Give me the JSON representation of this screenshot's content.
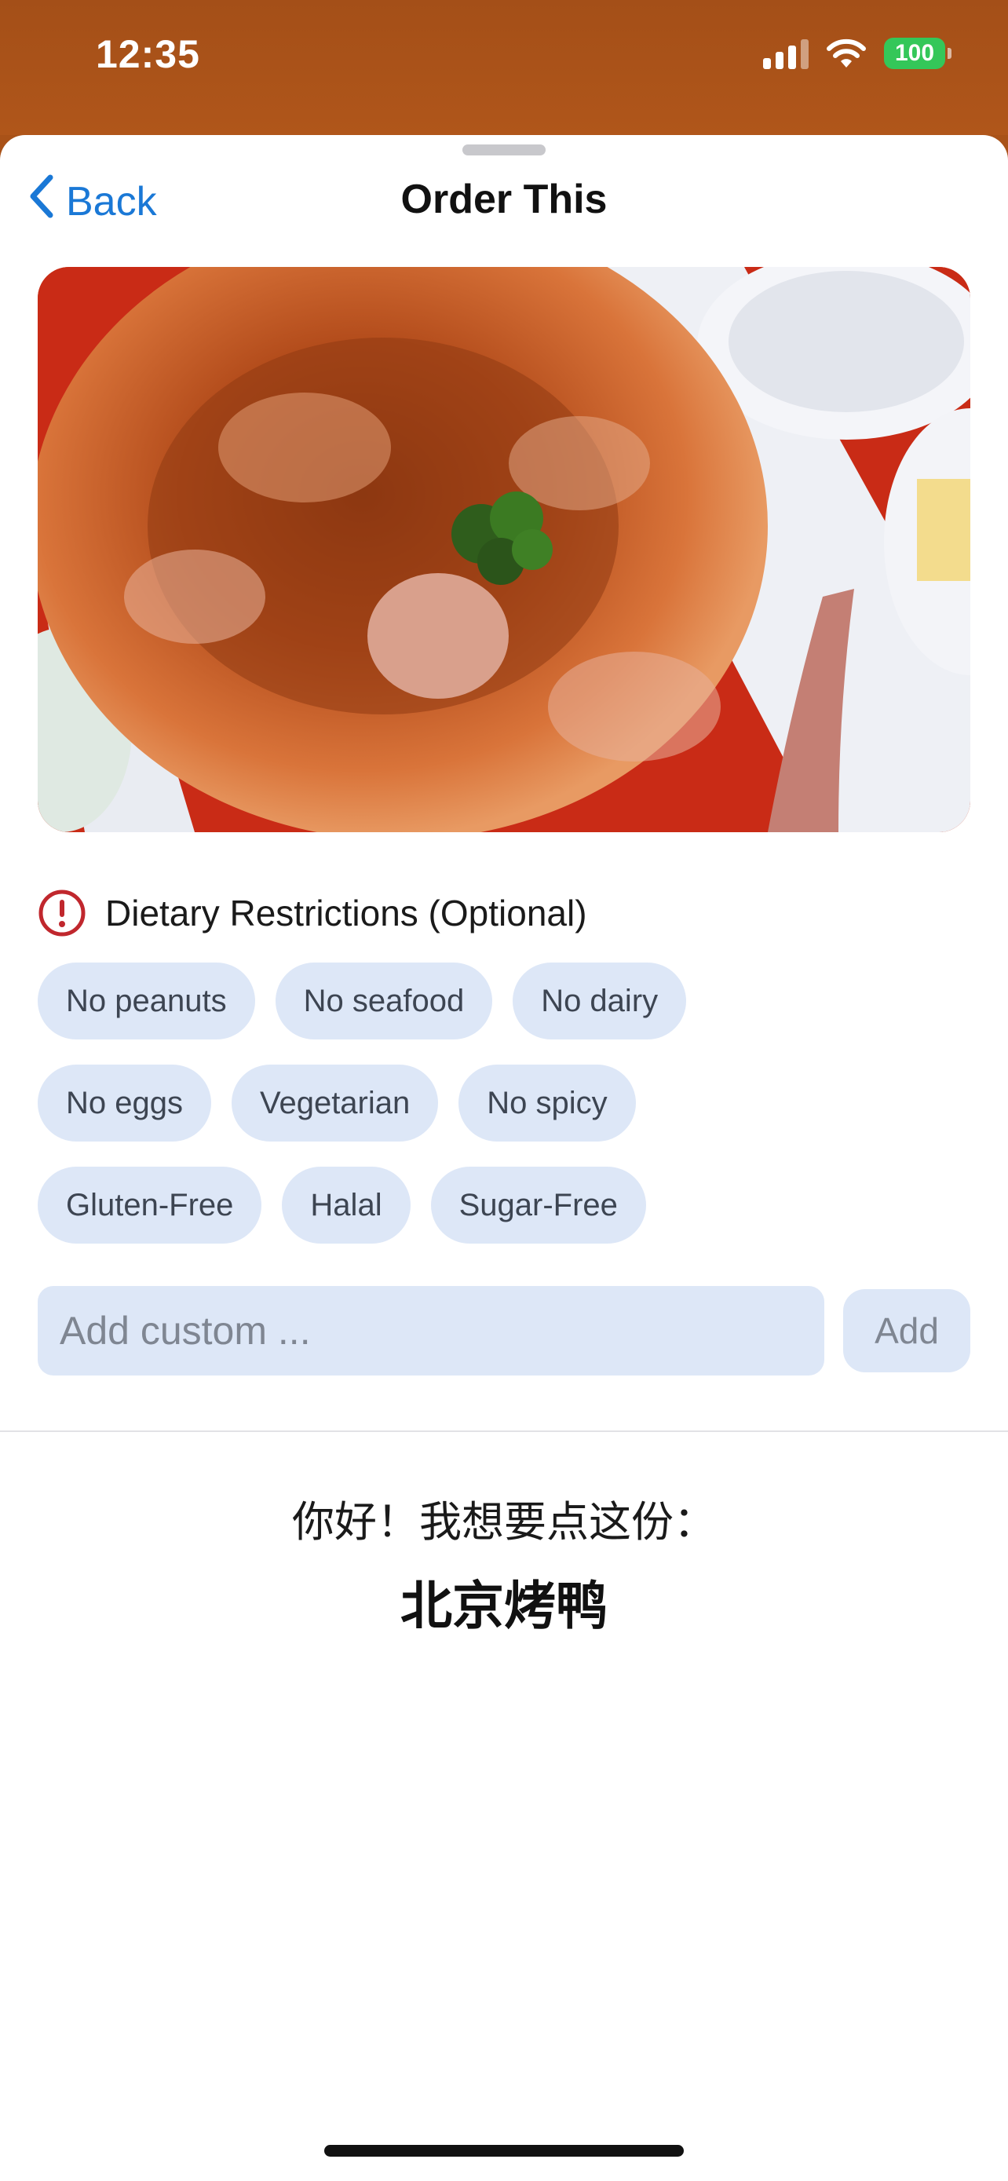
{
  "status_bar": {
    "time": "12:35",
    "battery": "100",
    "signal_bars": 3,
    "icons": [
      "signal-icon",
      "wifi-icon",
      "battery-icon"
    ]
  },
  "nav": {
    "back_label": "Back",
    "title": "Order This"
  },
  "dish_image": {
    "icon": "peking-duck-photo"
  },
  "dietary": {
    "title": "Dietary Restrictions (Optional)",
    "icon": "exclamation-circle-icon",
    "chips": [
      [
        "No peanuts",
        "No seafood",
        "No dairy"
      ],
      [
        "No eggs",
        "Vegetarian",
        "No spicy"
      ],
      [
        "Gluten-Free",
        "Halal",
        "Sugar-Free"
      ]
    ]
  },
  "custom": {
    "placeholder": "Add custom ...",
    "value": "",
    "add_label": "Add"
  },
  "order_card": {
    "greeting": "你好！我想要点这份：",
    "dish_name": "北京烤鸭"
  },
  "colors": {
    "accent": "#1a78d6",
    "chip_bg": "#dde7f7",
    "status_bar_bg": "#a95218",
    "alert": "#c0272d",
    "battery": "#34c759"
  }
}
